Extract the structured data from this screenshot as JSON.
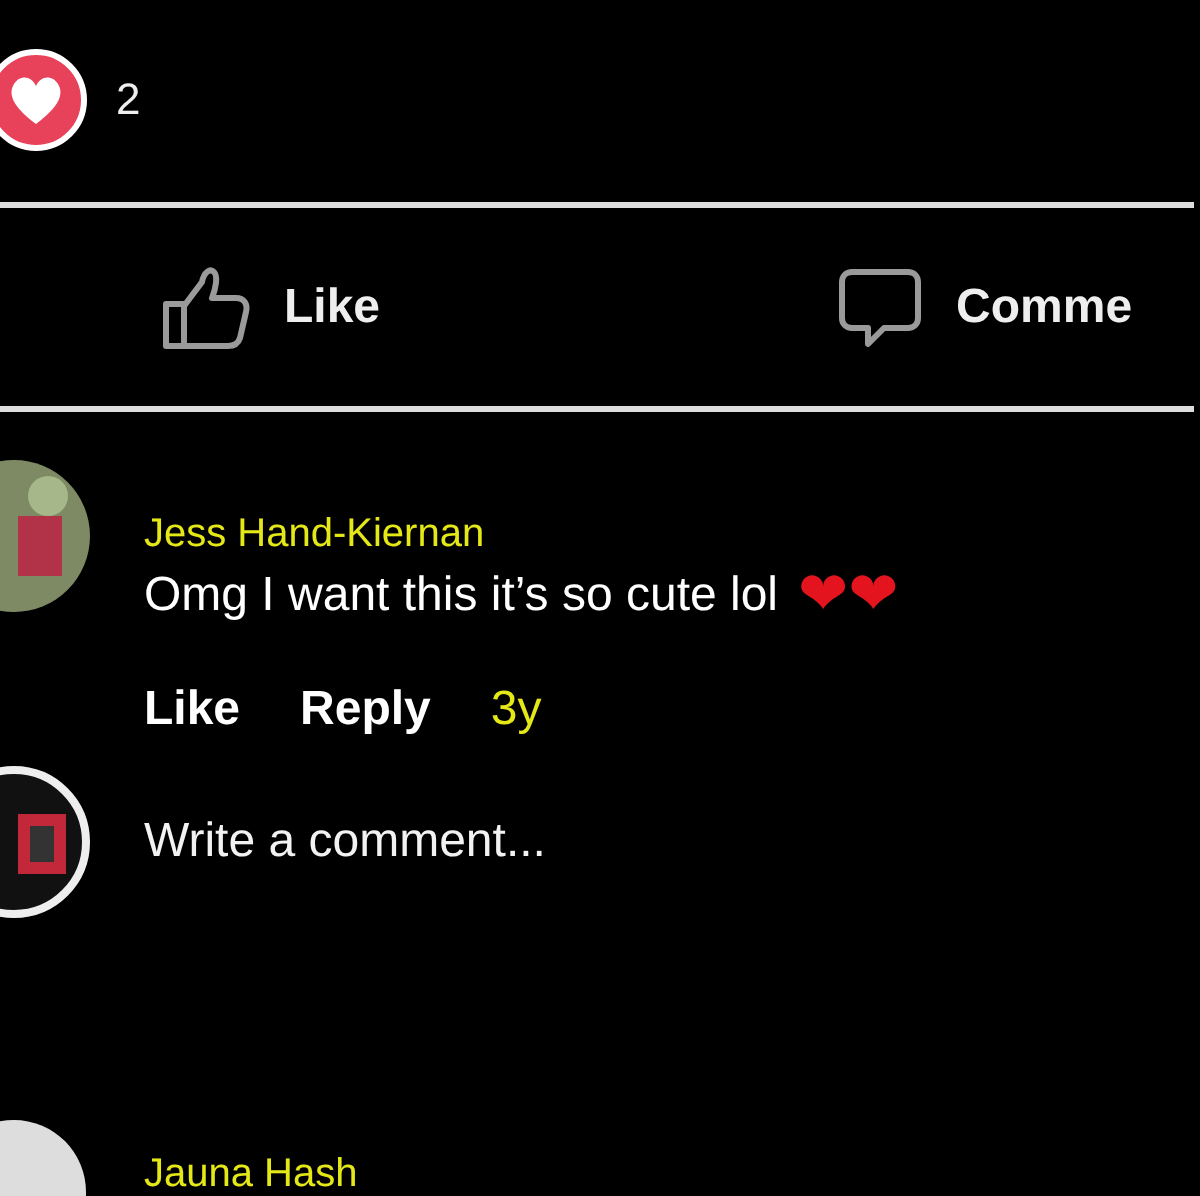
{
  "reactions": {
    "count": "2"
  },
  "actions": [
    {
      "kind": "like",
      "label": "Like"
    },
    {
      "kind": "comment",
      "label": "Comme"
    }
  ],
  "comments": [
    {
      "author": "Jess Hand-Kiernan",
      "text": "Omg I want this it’s so cute lol",
      "emoji": "❤❤",
      "links": [
        "Like",
        "Reply"
      ],
      "time": "3y"
    }
  ],
  "composer": {
    "placeholder": "Write a comment..."
  },
  "next_comment": {
    "author": "Jauna Hash"
  }
}
